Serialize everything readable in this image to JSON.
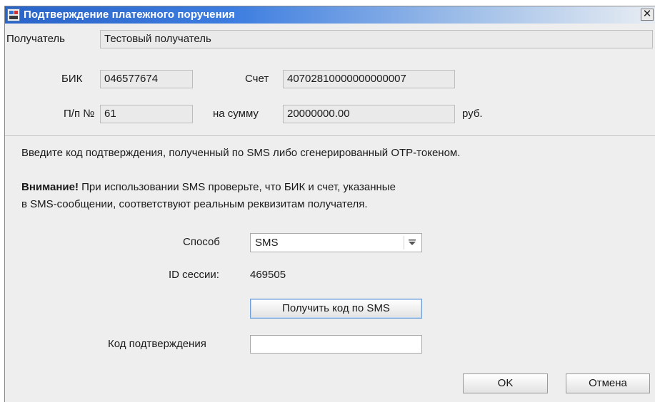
{
  "window": {
    "title": "Подтверждение платежного поручения",
    "close_glyph": "✕"
  },
  "recipient": {
    "label": "Получатель",
    "value": "Тестовый получатель"
  },
  "bik": {
    "label": "БИК",
    "value": "046577674"
  },
  "account": {
    "label": "Счет",
    "value": "40702810000000000007"
  },
  "order": {
    "label": "П/п №",
    "value": "61"
  },
  "amount": {
    "label": "на сумму",
    "value": "20000000.00",
    "currency": "руб."
  },
  "instructions": {
    "line1": "Введите код подтверждения, полученный по SMS либо сгенерированный OTP-токеном.",
    "warning_bold": "Внимание!",
    "warning_rest": " При использовании SMS проверьте, что БИК и счет, указанные",
    "warning_line2": "в SMS-сообщении, соответствуют реальным реквизитам получателя."
  },
  "method": {
    "label": "Способ",
    "selected": "SMS"
  },
  "session": {
    "label": "ID сессии:",
    "value": "469505"
  },
  "get_code_button": "Получить код по SMS",
  "code": {
    "label": "Код подтверждения",
    "value": ""
  },
  "buttons": {
    "ok": "OK",
    "cancel": "Отмена"
  }
}
